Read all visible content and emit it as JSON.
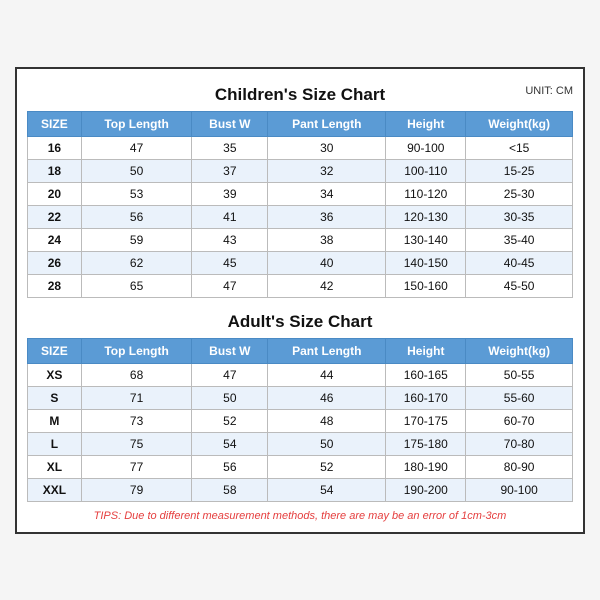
{
  "children": {
    "title": "Children's Size Chart",
    "unit": "UNIT: CM",
    "headers": [
      "SIZE",
      "Top Length",
      "Bust W",
      "Pant Length",
      "Height",
      "Weight(kg)"
    ],
    "rows": [
      [
        "16",
        "47",
        "35",
        "30",
        "90-100",
        "<15"
      ],
      [
        "18",
        "50",
        "37",
        "32",
        "100-110",
        "15-25"
      ],
      [
        "20",
        "53",
        "39",
        "34",
        "110-120",
        "25-30"
      ],
      [
        "22",
        "56",
        "41",
        "36",
        "120-130",
        "30-35"
      ],
      [
        "24",
        "59",
        "43",
        "38",
        "130-140",
        "35-40"
      ],
      [
        "26",
        "62",
        "45",
        "40",
        "140-150",
        "40-45"
      ],
      [
        "28",
        "65",
        "47",
        "42",
        "150-160",
        "45-50"
      ]
    ]
  },
  "adults": {
    "title": "Adult's Size Chart",
    "headers": [
      "SIZE",
      "Top Length",
      "Bust W",
      "Pant Length",
      "Height",
      "Weight(kg)"
    ],
    "rows": [
      [
        "XS",
        "68",
        "47",
        "44",
        "160-165",
        "50-55"
      ],
      [
        "S",
        "71",
        "50",
        "46",
        "160-170",
        "55-60"
      ],
      [
        "M",
        "73",
        "52",
        "48",
        "170-175",
        "60-70"
      ],
      [
        "L",
        "75",
        "54",
        "50",
        "175-180",
        "70-80"
      ],
      [
        "XL",
        "77",
        "56",
        "52",
        "180-190",
        "80-90"
      ],
      [
        "XXL",
        "79",
        "58",
        "54",
        "190-200",
        "90-100"
      ]
    ]
  },
  "tips": "TIPS: Due to different measurement methods, there are may be an error of 1cm-3cm"
}
